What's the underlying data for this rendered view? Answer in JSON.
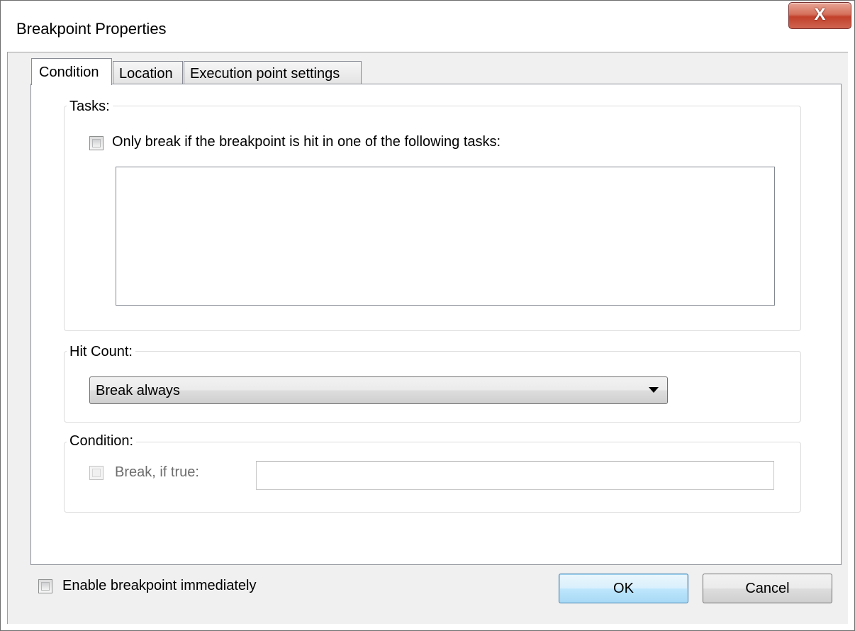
{
  "window": {
    "title": "Breakpoint Properties",
    "close_glyph": "X"
  },
  "tabs": [
    {
      "label": "Condition",
      "active": true
    },
    {
      "label": "Location",
      "active": false
    },
    {
      "label": "Execution point settings",
      "active": false
    }
  ],
  "tasks_group": {
    "label": "Tasks:",
    "checkbox_label": "Only break if the breakpoint is hit in one of the following tasks:",
    "checked": false,
    "items": []
  },
  "hit_count_group": {
    "label": "Hit Count:",
    "selected": "Break always"
  },
  "condition_group": {
    "label": "Condition:",
    "checkbox_label": "Break, if true:",
    "checked": false,
    "enabled": false,
    "expression": ""
  },
  "footer": {
    "enable_label": "Enable breakpoint immediately",
    "enable_checked": false,
    "ok_label": "OK",
    "cancel_label": "Cancel"
  },
  "icons": {
    "close": "close-icon",
    "dropdown": "chevron-down-icon"
  }
}
